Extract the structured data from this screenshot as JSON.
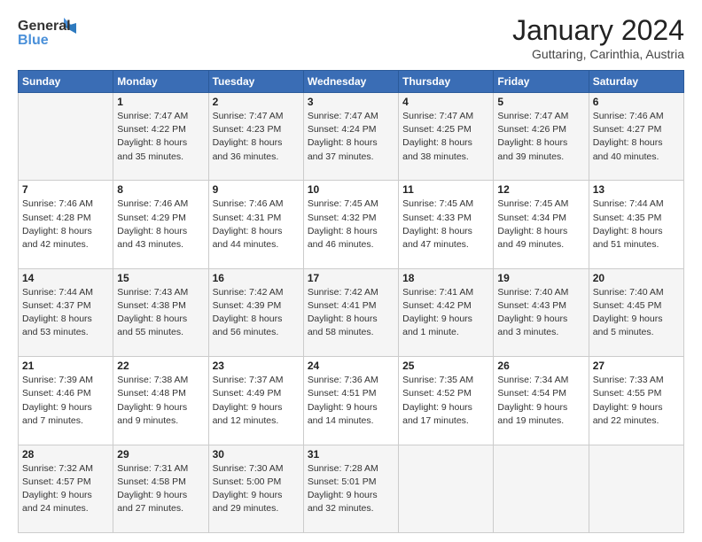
{
  "logo": {
    "line1": "General",
    "line2": "Blue"
  },
  "title": "January 2024",
  "location": "Guttaring, Carinthia, Austria",
  "days_header": [
    "Sunday",
    "Monday",
    "Tuesday",
    "Wednesday",
    "Thursday",
    "Friday",
    "Saturday"
  ],
  "weeks": [
    [
      {
        "num": "",
        "info": ""
      },
      {
        "num": "1",
        "info": "Sunrise: 7:47 AM\nSunset: 4:22 PM\nDaylight: 8 hours\nand 35 minutes."
      },
      {
        "num": "2",
        "info": "Sunrise: 7:47 AM\nSunset: 4:23 PM\nDaylight: 8 hours\nand 36 minutes."
      },
      {
        "num": "3",
        "info": "Sunrise: 7:47 AM\nSunset: 4:24 PM\nDaylight: 8 hours\nand 37 minutes."
      },
      {
        "num": "4",
        "info": "Sunrise: 7:47 AM\nSunset: 4:25 PM\nDaylight: 8 hours\nand 38 minutes."
      },
      {
        "num": "5",
        "info": "Sunrise: 7:47 AM\nSunset: 4:26 PM\nDaylight: 8 hours\nand 39 minutes."
      },
      {
        "num": "6",
        "info": "Sunrise: 7:46 AM\nSunset: 4:27 PM\nDaylight: 8 hours\nand 40 minutes."
      }
    ],
    [
      {
        "num": "7",
        "info": "Sunrise: 7:46 AM\nSunset: 4:28 PM\nDaylight: 8 hours\nand 42 minutes."
      },
      {
        "num": "8",
        "info": "Sunrise: 7:46 AM\nSunset: 4:29 PM\nDaylight: 8 hours\nand 43 minutes."
      },
      {
        "num": "9",
        "info": "Sunrise: 7:46 AM\nSunset: 4:31 PM\nDaylight: 8 hours\nand 44 minutes."
      },
      {
        "num": "10",
        "info": "Sunrise: 7:45 AM\nSunset: 4:32 PM\nDaylight: 8 hours\nand 46 minutes."
      },
      {
        "num": "11",
        "info": "Sunrise: 7:45 AM\nSunset: 4:33 PM\nDaylight: 8 hours\nand 47 minutes."
      },
      {
        "num": "12",
        "info": "Sunrise: 7:45 AM\nSunset: 4:34 PM\nDaylight: 8 hours\nand 49 minutes."
      },
      {
        "num": "13",
        "info": "Sunrise: 7:44 AM\nSunset: 4:35 PM\nDaylight: 8 hours\nand 51 minutes."
      }
    ],
    [
      {
        "num": "14",
        "info": "Sunrise: 7:44 AM\nSunset: 4:37 PM\nDaylight: 8 hours\nand 53 minutes."
      },
      {
        "num": "15",
        "info": "Sunrise: 7:43 AM\nSunset: 4:38 PM\nDaylight: 8 hours\nand 55 minutes."
      },
      {
        "num": "16",
        "info": "Sunrise: 7:42 AM\nSunset: 4:39 PM\nDaylight: 8 hours\nand 56 minutes."
      },
      {
        "num": "17",
        "info": "Sunrise: 7:42 AM\nSunset: 4:41 PM\nDaylight: 8 hours\nand 58 minutes."
      },
      {
        "num": "18",
        "info": "Sunrise: 7:41 AM\nSunset: 4:42 PM\nDaylight: 9 hours\nand 1 minute."
      },
      {
        "num": "19",
        "info": "Sunrise: 7:40 AM\nSunset: 4:43 PM\nDaylight: 9 hours\nand 3 minutes."
      },
      {
        "num": "20",
        "info": "Sunrise: 7:40 AM\nSunset: 4:45 PM\nDaylight: 9 hours\nand 5 minutes."
      }
    ],
    [
      {
        "num": "21",
        "info": "Sunrise: 7:39 AM\nSunset: 4:46 PM\nDaylight: 9 hours\nand 7 minutes."
      },
      {
        "num": "22",
        "info": "Sunrise: 7:38 AM\nSunset: 4:48 PM\nDaylight: 9 hours\nand 9 minutes."
      },
      {
        "num": "23",
        "info": "Sunrise: 7:37 AM\nSunset: 4:49 PM\nDaylight: 9 hours\nand 12 minutes."
      },
      {
        "num": "24",
        "info": "Sunrise: 7:36 AM\nSunset: 4:51 PM\nDaylight: 9 hours\nand 14 minutes."
      },
      {
        "num": "25",
        "info": "Sunrise: 7:35 AM\nSunset: 4:52 PM\nDaylight: 9 hours\nand 17 minutes."
      },
      {
        "num": "26",
        "info": "Sunrise: 7:34 AM\nSunset: 4:54 PM\nDaylight: 9 hours\nand 19 minutes."
      },
      {
        "num": "27",
        "info": "Sunrise: 7:33 AM\nSunset: 4:55 PM\nDaylight: 9 hours\nand 22 minutes."
      }
    ],
    [
      {
        "num": "28",
        "info": "Sunrise: 7:32 AM\nSunset: 4:57 PM\nDaylight: 9 hours\nand 24 minutes."
      },
      {
        "num": "29",
        "info": "Sunrise: 7:31 AM\nSunset: 4:58 PM\nDaylight: 9 hours\nand 27 minutes."
      },
      {
        "num": "30",
        "info": "Sunrise: 7:30 AM\nSunset: 5:00 PM\nDaylight: 9 hours\nand 29 minutes."
      },
      {
        "num": "31",
        "info": "Sunrise: 7:28 AM\nSunset: 5:01 PM\nDaylight: 9 hours\nand 32 minutes."
      },
      {
        "num": "",
        "info": ""
      },
      {
        "num": "",
        "info": ""
      },
      {
        "num": "",
        "info": ""
      }
    ]
  ]
}
